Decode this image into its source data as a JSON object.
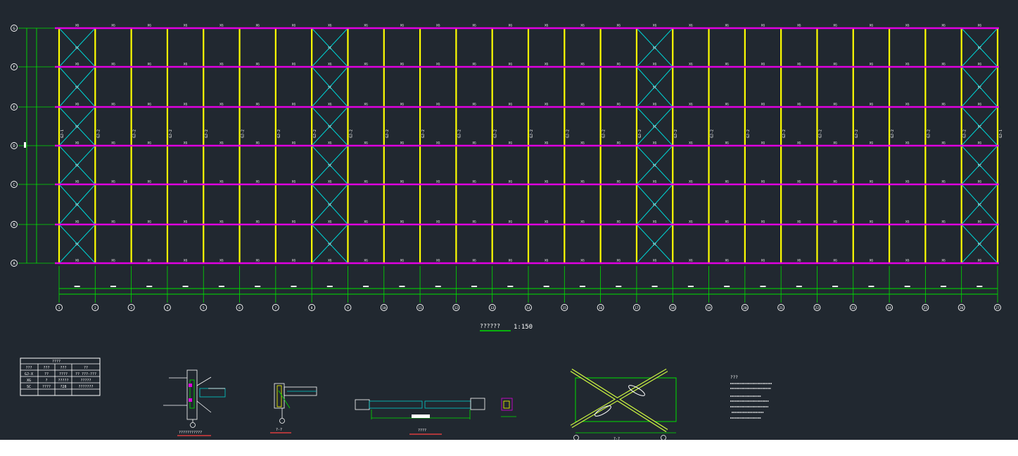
{
  "colors": {
    "background": "#212830",
    "purlin": "#e000e0",
    "column": "#ffff00",
    "bracing": "#00cccc",
    "dimension": "#00e000",
    "text": "#ffffff"
  },
  "plan": {
    "row_axes": [
      "G",
      "F",
      "E",
      "D",
      "C",
      "B",
      "A"
    ],
    "column_axes": [
      "1",
      "2",
      "3",
      "4",
      "5",
      "6",
      "7",
      "8",
      "9",
      "10",
      "11",
      "12",
      "13",
      "14",
      "15",
      "16",
      "17",
      "18",
      "19",
      "20",
      "21",
      "22",
      "23",
      "24",
      "25",
      "26",
      "27"
    ],
    "purlin_label": "XG",
    "bracing_label": "SC",
    "column_label": "GJ-2",
    "end_column_label": "GJ-1",
    "braced_bays": [
      1,
      8,
      17,
      26
    ],
    "title_caption": "??????",
    "scale": "1:150"
  },
  "table": {
    "title": "????",
    "headers": [
      "???",
      "???",
      "???",
      "??"
    ],
    "rows": [
      [
        "GJ-X",
        "??",
        "????",
        "?? ???-???"
      ],
      [
        "XG",
        "?",
        "?????",
        "?????"
      ],
      [
        "SC",
        "????",
        "?28",
        "???????"
      ]
    ]
  },
  "details": {
    "detail1_caption": "???????????",
    "detail2_caption": "?-?",
    "detail3_caption": "????",
    "detail4_caption": "?-?",
    "notes_title": "???"
  }
}
